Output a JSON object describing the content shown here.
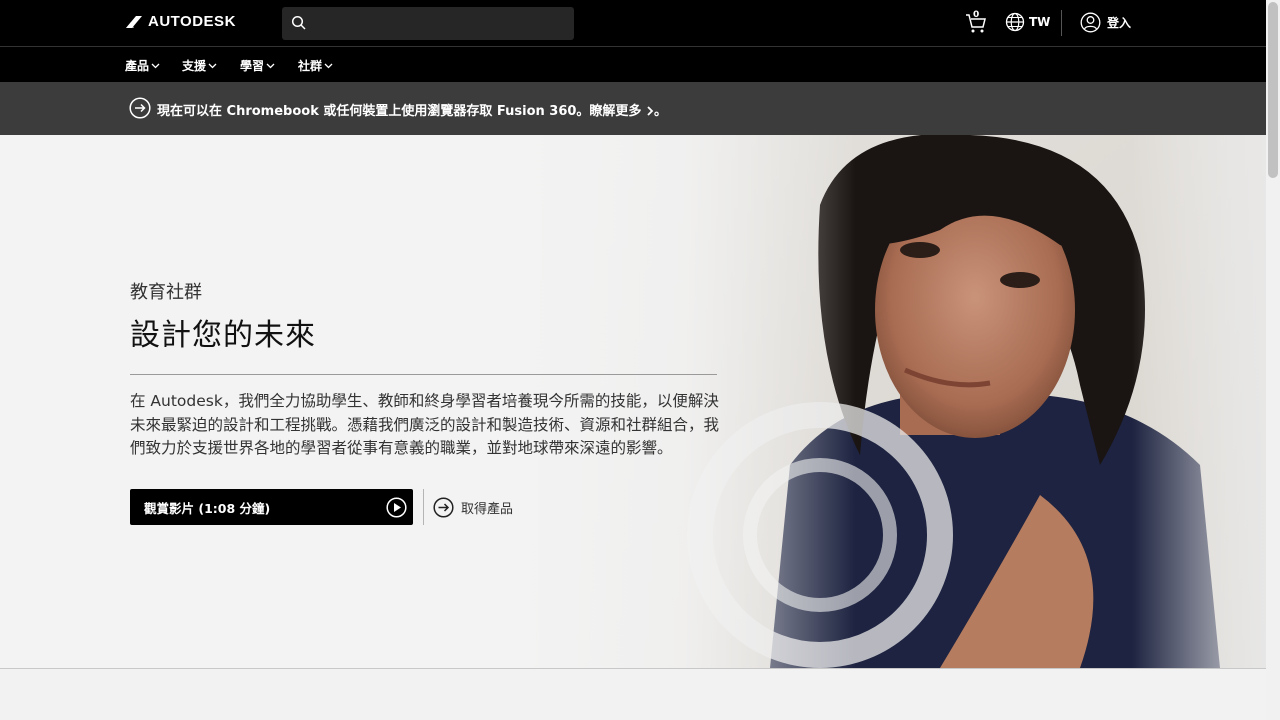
{
  "header": {
    "brand": "AUTODESK",
    "search_placeholder": "",
    "cart_count": "0",
    "region_label": "TW",
    "signin_label": "登入"
  },
  "nav": {
    "items": [
      {
        "label": "產品"
      },
      {
        "label": "支援"
      },
      {
        "label": "學習"
      },
      {
        "label": "社群"
      }
    ]
  },
  "banner": {
    "text": "現在可以在 Chromebook 或任何裝置上使用瀏覽器存取 Fusion 360。",
    "link": "瞭解更多",
    "suffix": "。"
  },
  "hero": {
    "eyebrow": "教育社群",
    "headline": "設計您的未來",
    "description": "在 Autodesk，我們全力協助學生、教師和終身學習者培養現今所需的技能，以便解決未來最緊迫的設計和工程挑戰。憑藉我們廣泛的設計和製造技術、資源和社群組合，我們致力於支援世界各地的學習者從事有意義的職業，並對地球帶來深遠的影響。",
    "video_button": "觀賞影片 (1:08 分鐘)",
    "products_link": "取得產品"
  },
  "colors": {
    "topbar": "#000000",
    "banner": "#3c3c3c",
    "hero_bg": "#f3f3f3"
  }
}
